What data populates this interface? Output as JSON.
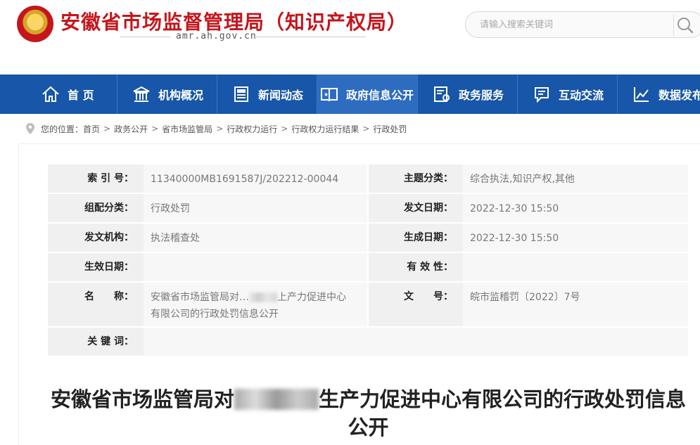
{
  "header": {
    "title": "安徽省市场监督管理局（知识产权局）",
    "domain": "amr.ah.gov.cn",
    "search_placeholder": "请输入搜索关键词"
  },
  "nav": [
    {
      "label": "首 页",
      "icon": "home-icon"
    },
    {
      "label": "机构概况",
      "icon": "building-icon"
    },
    {
      "label": "新闻动态",
      "icon": "news-icon"
    },
    {
      "label": "政府信息公开",
      "icon": "info-book-icon",
      "active": true
    },
    {
      "label": "政务服务",
      "icon": "service-doc-icon"
    },
    {
      "label": "互动交流",
      "icon": "chat-icon"
    },
    {
      "label": "数据发布",
      "icon": "chart-icon"
    }
  ],
  "breadcrumb": {
    "prefix": "您的位置：",
    "items": [
      "首页",
      "政务公开",
      "省市场监管局",
      "行政权力运行",
      "行政权力运行结果",
      "行政处罚"
    ]
  },
  "meta": {
    "index_label": "索 引 号：",
    "index_value": "11340000MB1691587J/202212-00044",
    "topic_label": "主题分类：",
    "topic_value": "综合执法,知识产权,其他",
    "category_label": "组配分类：",
    "category_value": "行政处罚",
    "issue_date_label": "发文日期：",
    "issue_date_value": "2022-12-30 15:50",
    "org_label": "发文机构：",
    "org_value": "执法稽查处",
    "create_date_label": "生成日期：",
    "create_date_value": "2022-12-30 15:50",
    "effective_label": "生效日期：",
    "effective_value": "",
    "validity_label": "有 效 性：",
    "validity_value": "",
    "name_label": "名　　称：",
    "name_value_part1": "安徽省市场监管局对…",
    "name_value_part2": "上产力促进中心",
    "name_value_line2": "有限公司的行政处罚信息公开",
    "doc_no_label": "文　　号：",
    "doc_no_value": "皖市监稽罚〔2022〕7号",
    "keywords_label": "关 键 词：",
    "keywords_value": ""
  },
  "article": {
    "title_part1": "安徽省市场监管局对",
    "title_part2": "生产力促进中心有限公司的行政处罚信息公开"
  },
  "colors": {
    "brand_red": "#c4161c",
    "nav_blue": "#1756a8",
    "nav_active": "#2e6cc0"
  }
}
